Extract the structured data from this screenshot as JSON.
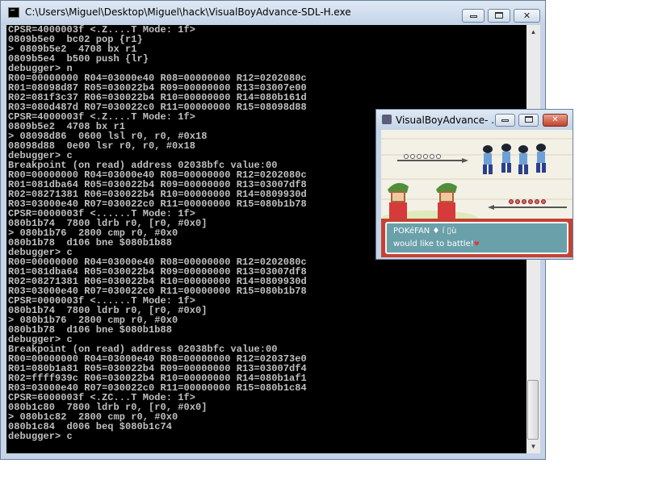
{
  "console": {
    "title": "C:\\Users\\Miguel\\Desktop\\Miguel\\hack\\VisualBoyAdvance-SDL-H.exe",
    "lines": [
      "CPSR=4000003f <.Z....T Mode: 1f>",
      "0809b5e0  bc02 pop {r1}",
      "> 0809b5e2  4708 bx r1",
      "0809b5e4  b500 push {lr}",
      "debugger> n",
      "R00=00000000 R04=03000e40 R08=00000000 R12=0202080c",
      "R01=08098d87 R05=030022b4 R09=00000000 R13=03007e00",
      "R02=081f3c37 R06=030022b4 R10=00000000 R14=080b161d",
      "R03=080d487d R07=030022c0 R11=00000000 R15=08098d88",
      "CPSR=4000003f <.Z....T Mode: 1f>",
      "0809b5e2  4708 bx r1",
      "> 08098d86  0600 lsl r0, r0, #0x18",
      "08098d88  0e00 lsr r0, r0, #0x18",
      "debugger> c",
      "Breakpoint (on read) address 02038bfc value:00",
      "R00=00000000 R04=03000e40 R08=00000000 R12=0202080c",
      "R01=081dba64 R05=030022b4 R09=00000000 R13=03007df8",
      "R02=08271381 R06=030022b4 R10=00000000 R14=0809930d",
      "R03=03000e40 R07=030022c0 R11=00000000 R15=080b1b78",
      "CPSR=0000003f <......T Mode: 1f>",
      "080b1b74  7800 ldrb r0, [r0, #0x0]",
      "> 080b1b76  2800 cmp r0, #0x0",
      "080b1b78  d106 bne $080b1b88",
      "debugger> c",
      "R00=00000000 R04=03000e40 R08=00000000 R12=0202080c",
      "R01=081dba64 R05=030022b4 R09=00000000 R13=03007df8",
      "R02=08271381 R06=030022b4 R10=00000000 R14=0809930d",
      "R03=03000e40 R07=030022c0 R11=00000000 R15=080b1b78",
      "CPSR=0000003f <......T Mode: 1f>",
      "080b1b74  7800 ldrb r0, [r0, #0x0]",
      "> 080b1b76  2800 cmp r0, #0x0",
      "080b1b78  d106 bne $080b1b88",
      "debugger> c",
      "Breakpoint (on read) address 02038bfc value:00",
      "R00=00000000 R04=03000e40 R08=00000000 R12=020373e0",
      "R01=080b1a81 R05=030022b4 R09=00000000 R13=03007df4",
      "R02=ffff939c R06=030022b4 R10=00000000 R14=080b1af1",
      "R03=03000e40 R07=030022c0 R11=00000000 R15=080b1c84",
      "CPSR=6000003f <.ZC...T Mode: 1f>",
      "080b1c80  7800 ldrb r0, [r0, #0x0]",
      "> 080b1c82  2800 cmp r0, #0x0",
      "080b1c84  d006 beq $080b1c74",
      "debugger> c"
    ]
  },
  "vba": {
    "title": "VisualBoyAdvance- ...",
    "dialog_line1": "POKéFAN ♦ í ▯ù",
    "dialog_line2": "would like to battle!"
  },
  "colors": {
    "console_bg": "#000000",
    "console_text": "#c0c0c0",
    "dialog_bg": "#6aa0aa",
    "dialog_border": "#c44234"
  },
  "icons": [
    "console-app-icon",
    "vba-app-icon",
    "minimize-icon",
    "maximize-icon",
    "close-icon",
    "scroll-up-icon",
    "scroll-down-icon",
    "heart-icon"
  ]
}
